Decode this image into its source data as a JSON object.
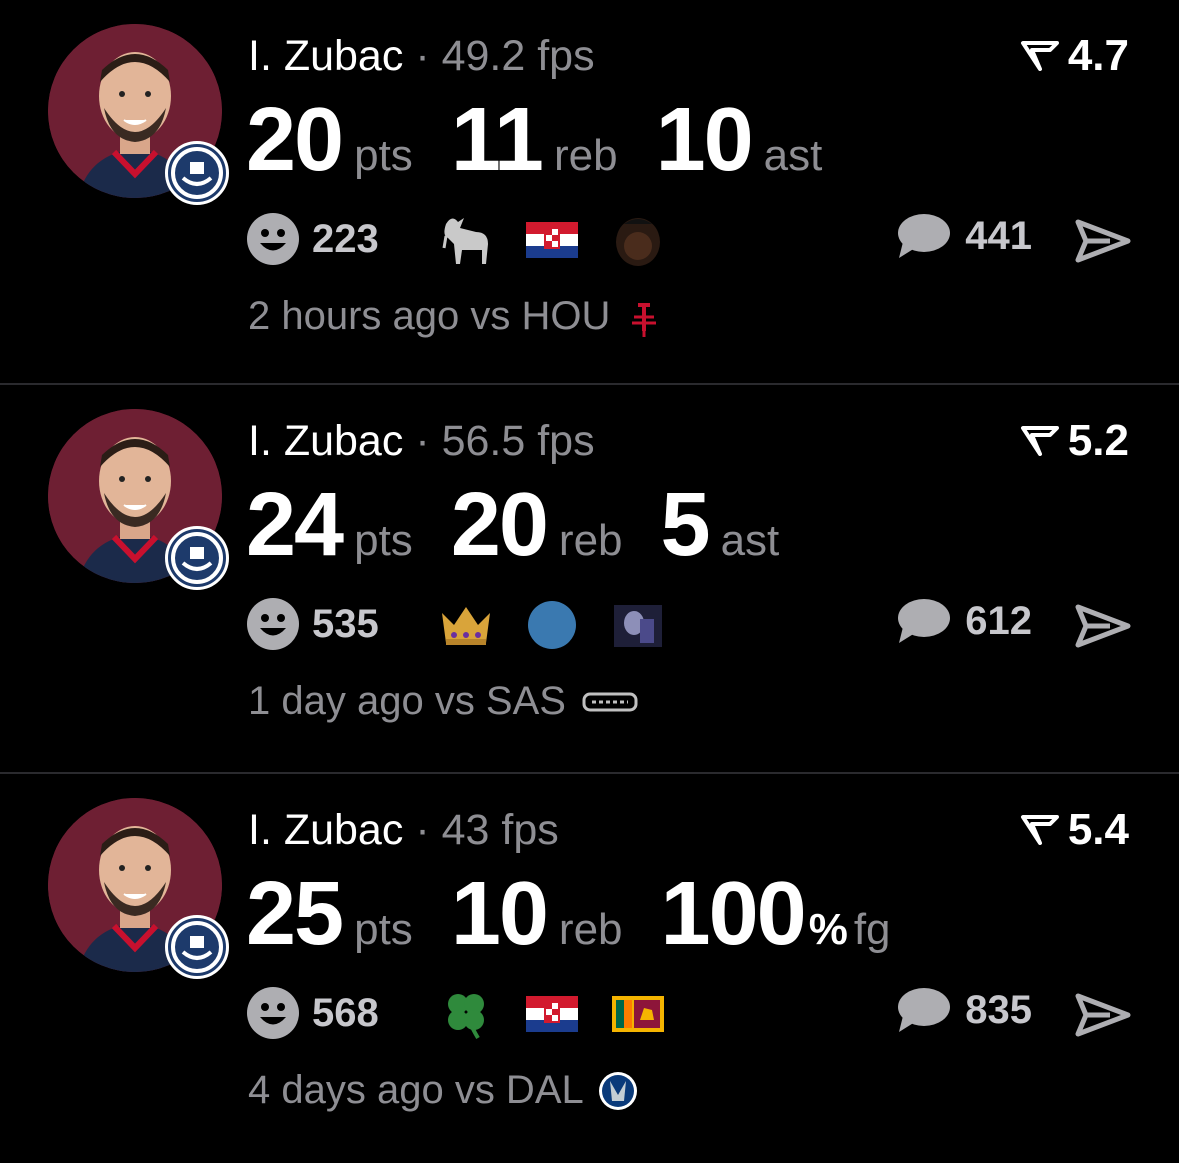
{
  "posts": [
    {
      "player": "I. Zubac",
      "sep": "·",
      "fps": "49.2 fps",
      "rating": "4.7",
      "stats": [
        {
          "value": "20",
          "unit": "pts"
        },
        {
          "value": "11",
          "unit": "reb"
        },
        {
          "value": "10",
          "unit": "ast"
        }
      ],
      "reactions": "223",
      "emojis": [
        "goat-icon",
        "croatia-flag-icon",
        "player-meme-icon"
      ],
      "comments": "441",
      "time_opponent": "2 hours ago vs HOU",
      "opponent_logo": "rockets-logo-icon"
    },
    {
      "player": "I. Zubac",
      "sep": "·",
      "fps": "56.5 fps",
      "rating": "5.2",
      "stats": [
        {
          "value": "24",
          "unit": "pts"
        },
        {
          "value": "20",
          "unit": "reb"
        },
        {
          "value": "5",
          "unit": "ast"
        }
      ],
      "reactions": "535",
      "emojis": [
        "crown-icon",
        "blue-circle-icon",
        "toy-story-meme-icon"
      ],
      "comments": "612",
      "time_opponent": "1 day ago vs SAS",
      "opponent_logo": "spurs-logo-icon"
    },
    {
      "player": "I. Zubac",
      "sep": "·",
      "fps": "43 fps",
      "rating": "5.4",
      "stats": [
        {
          "value": "25",
          "unit": "pts"
        },
        {
          "value": "10",
          "unit": "reb"
        },
        {
          "value": "100",
          "unit": "%",
          "suffix": "fg"
        }
      ],
      "reactions": "568",
      "emojis": [
        "four-leaf-clover-icon",
        "croatia-flag-icon",
        "sri-lanka-flag-icon"
      ],
      "comments": "835",
      "time_opponent": "4 days ago vs DAL",
      "opponent_logo": "mavericks-logo-icon"
    }
  ],
  "colors": {
    "background": "#000000",
    "secondary_text": "#8e8e93",
    "avatar_bg": "#6e1f33",
    "divider": "#2a2a2e"
  }
}
